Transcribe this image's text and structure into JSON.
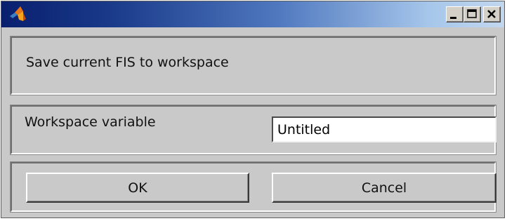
{
  "window": {
    "title": "",
    "icon": "matlab-logo-icon",
    "controls": [
      "minimize-icon",
      "maximize-icon",
      "close-icon"
    ]
  },
  "dialog": {
    "heading": "Save current FIS to workspace",
    "variable_label": "Workspace variable",
    "variable_value": "Untitled",
    "ok_label": "OK",
    "cancel_label": "Cancel"
  },
  "colors": {
    "titlebar_start": "#081f6e",
    "titlebar_end": "#c2d7ef",
    "window_bg": "#c9c9c9"
  }
}
